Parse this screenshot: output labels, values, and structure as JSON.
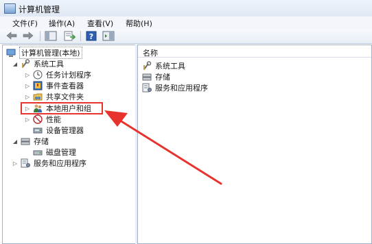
{
  "window": {
    "title": "计算机管理"
  },
  "menu": {
    "items": [
      "文件(F)",
      "操作(A)",
      "查看(V)",
      "帮助(H)"
    ]
  },
  "toolbar": {
    "buttons": [
      "back-icon",
      "forward-icon",
      "show-hide-tree-icon",
      "export-list-icon",
      "help-icon",
      "show-hide-action-pane-icon"
    ]
  },
  "tree": {
    "root": "计算机管理(本地)",
    "system_tools": "系统工具",
    "task_scheduler": "任务计划程序",
    "event_viewer": "事件查看器",
    "shared_folders": "共享文件夹",
    "local_users_groups": "本地用户和组",
    "performance": "性能",
    "device_manager": "设备管理器",
    "storage": "存储",
    "disk_management": "磁盘管理",
    "services_apps": "服务和应用程序"
  },
  "list": {
    "column_name": "名称",
    "items": [
      "系统工具",
      "存储",
      "服务和应用程序"
    ]
  },
  "annotation": {
    "color": "#e8322d",
    "highlighted_item": "本地用户和组"
  }
}
